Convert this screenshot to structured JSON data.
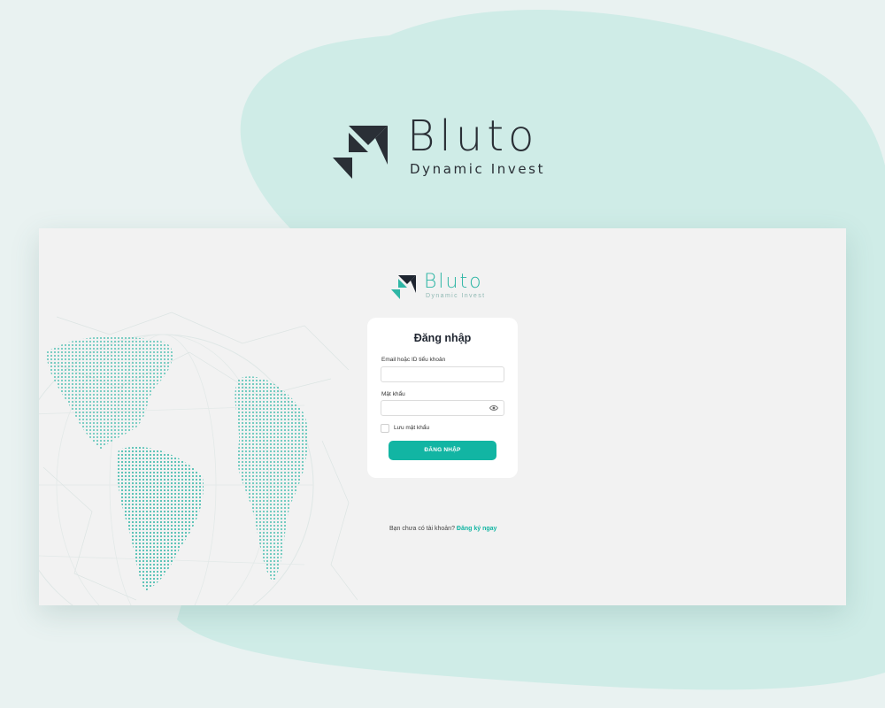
{
  "brand": {
    "title": "Bluto",
    "subtitle": "Dynamic Invest"
  },
  "app_logo": {
    "title": "Bluto",
    "subtitle": "Dynamic Invest"
  },
  "login": {
    "title": "Đăng nhập",
    "email_label": "Email hoặc ID tiểu khoản",
    "email_value": "",
    "password_label": "Mật khẩu",
    "password_value": "",
    "remember_label": "Lưu mật khẩu",
    "remember_checked": false,
    "submit_label": "ĐĂNG NHẬP"
  },
  "signup": {
    "prompt": "Bạn chưa có tài khoản?",
    "link_label": "Đăng ký ngay"
  },
  "colors": {
    "accent": "#12b5a3",
    "blob": "#cfece7",
    "page_bg": "#e9f2f1",
    "app_bg": "#f2f2f2",
    "logo_dark": "#2a2f36"
  },
  "icons": {
    "brand_mark": "bluto-logo-icon",
    "password_toggle": "eye-icon"
  }
}
